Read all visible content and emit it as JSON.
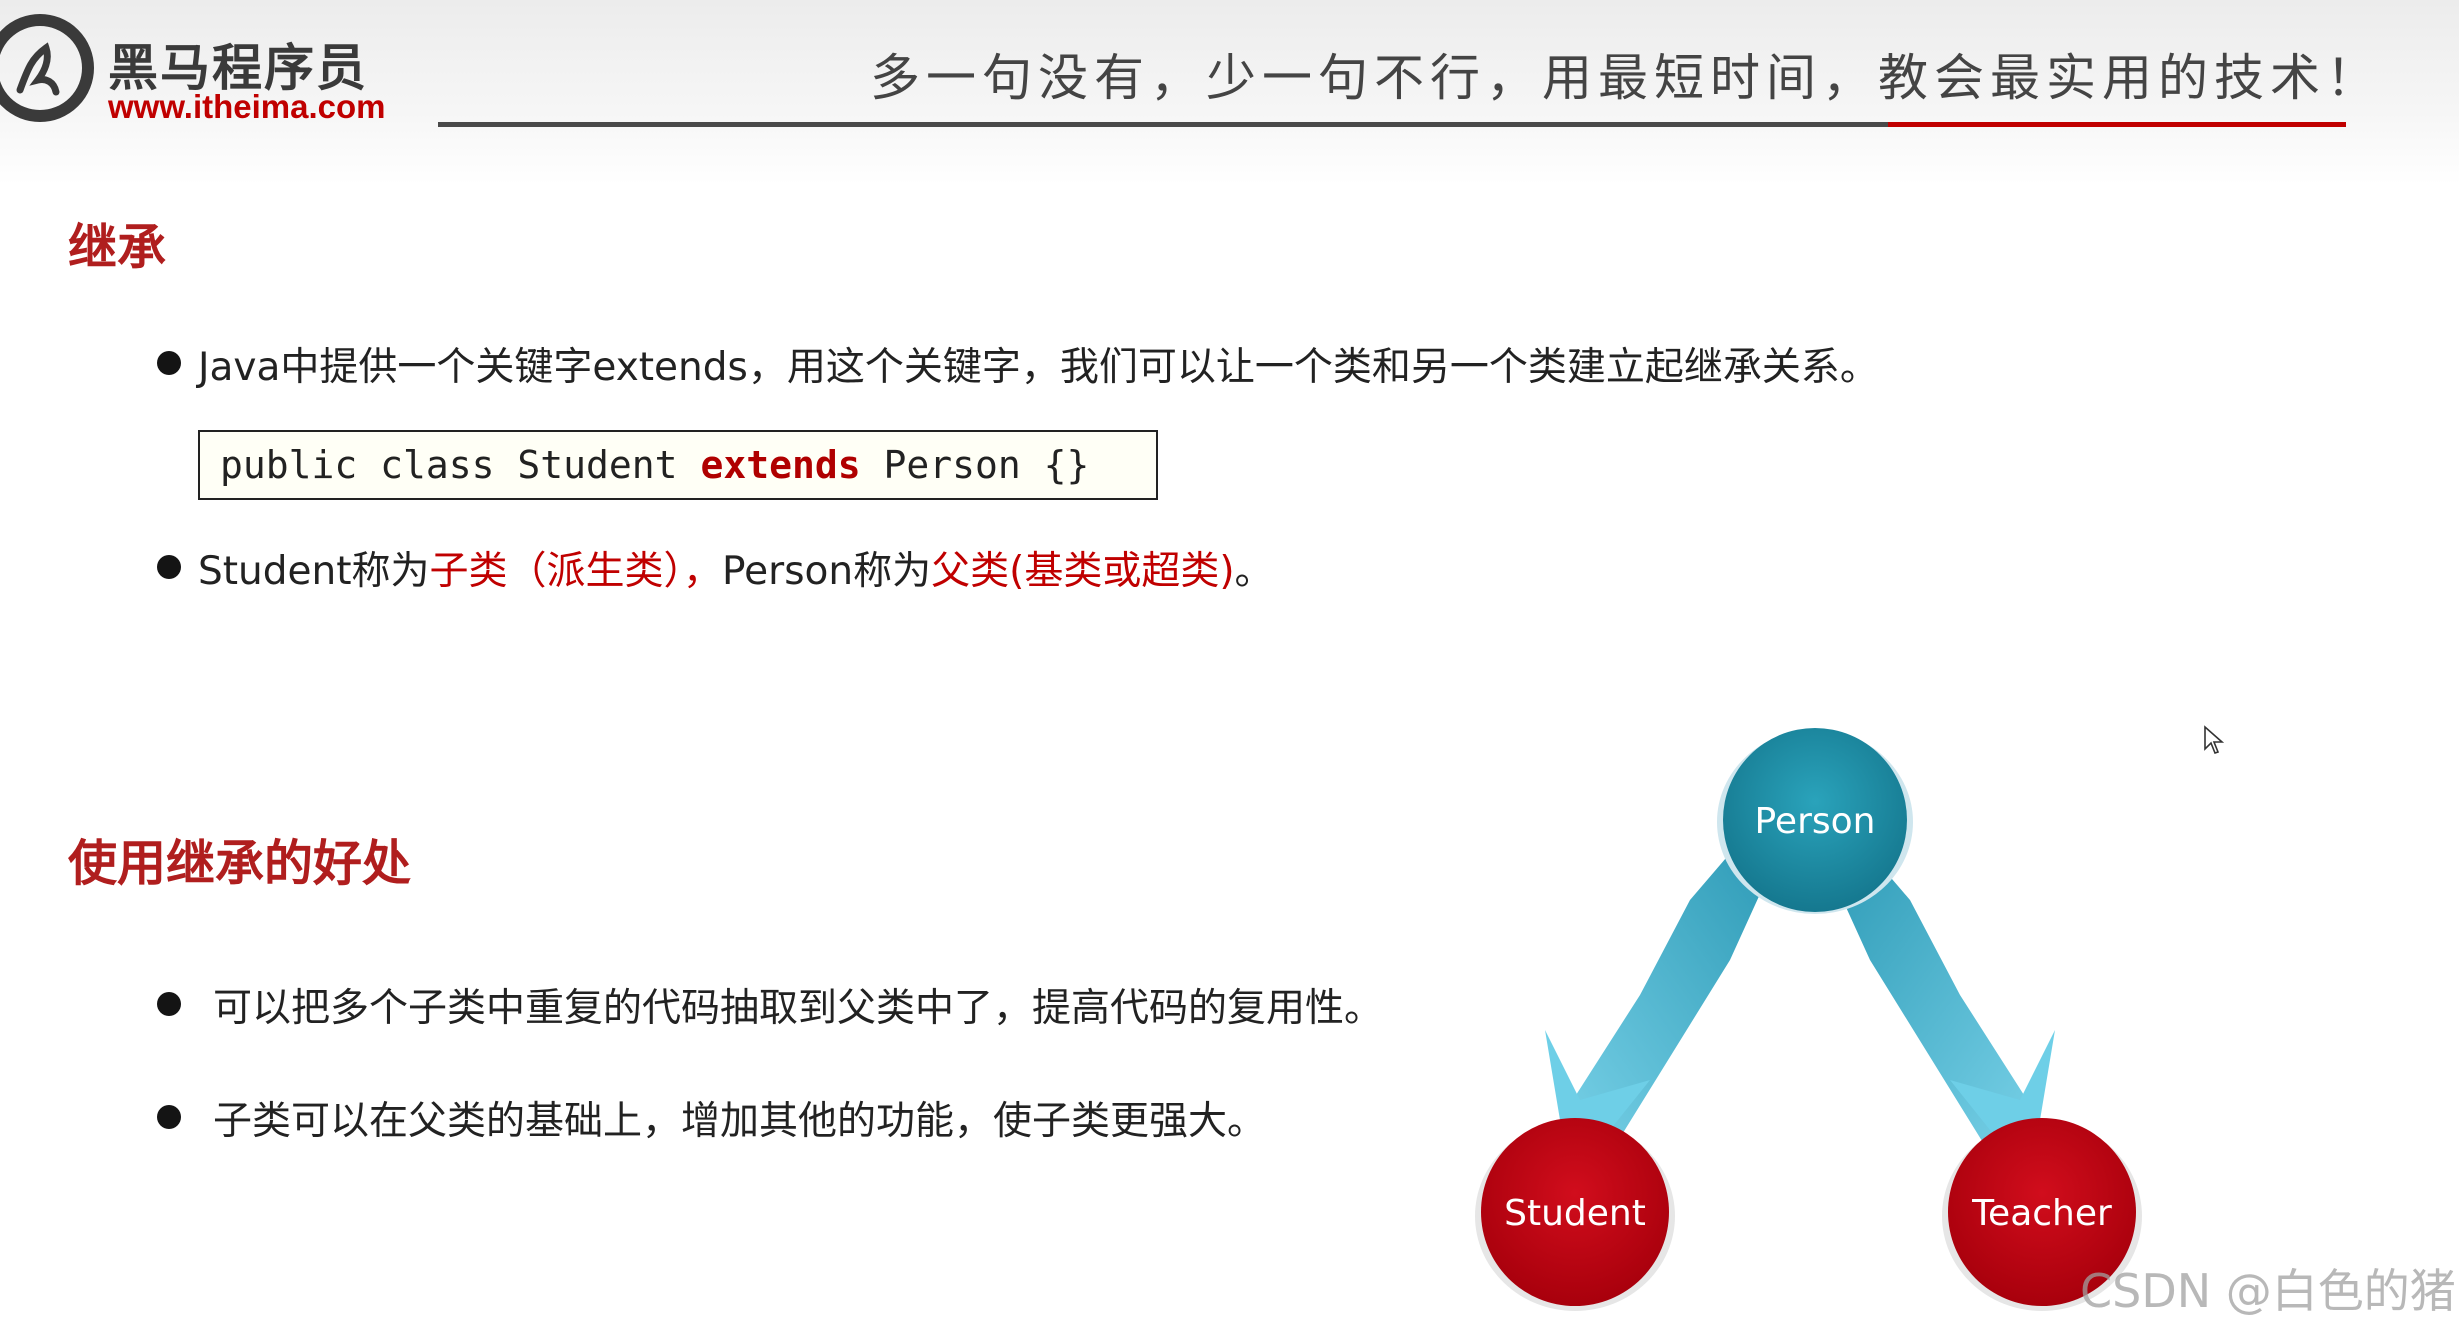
{
  "header": {
    "logo_cn": "黑马程序员",
    "logo_url": "www.itheima.com",
    "slogan": "多一句没有，少一句不行，用最短时间，教会最实用的技术！",
    "accent_color": "#c00000"
  },
  "section1": {
    "title": "继承",
    "bullet1": "Java中提供一个关键字extends，用这个关键字，我们可以让一个类和另一个类建立起继承关系。",
    "code": {
      "before": "public class Student ",
      "keyword": "extends",
      "after": " Person {}"
    },
    "bullet2": {
      "part1": "Student称为",
      "part2": "子类（派生类），",
      "part3": "Person称为",
      "part4": "父类(基类或超类)",
      "part5": "。"
    }
  },
  "section2": {
    "title": "使用继承的好处",
    "bullet1": "可以把多个子类中重复的代码抽取到父类中了，提高代码的复用性。",
    "bullet2": "子类可以在父类的基础上，增加其他的功能，使子类更强大。"
  },
  "diagram": {
    "parent": "Person",
    "child_left": "Student",
    "child_right": "Teacher",
    "parent_color": "#1f8ea6",
    "child_color": "#c40010",
    "arrow_color": "#5ec8e2"
  },
  "watermark": "CSDN @白色的猪"
}
